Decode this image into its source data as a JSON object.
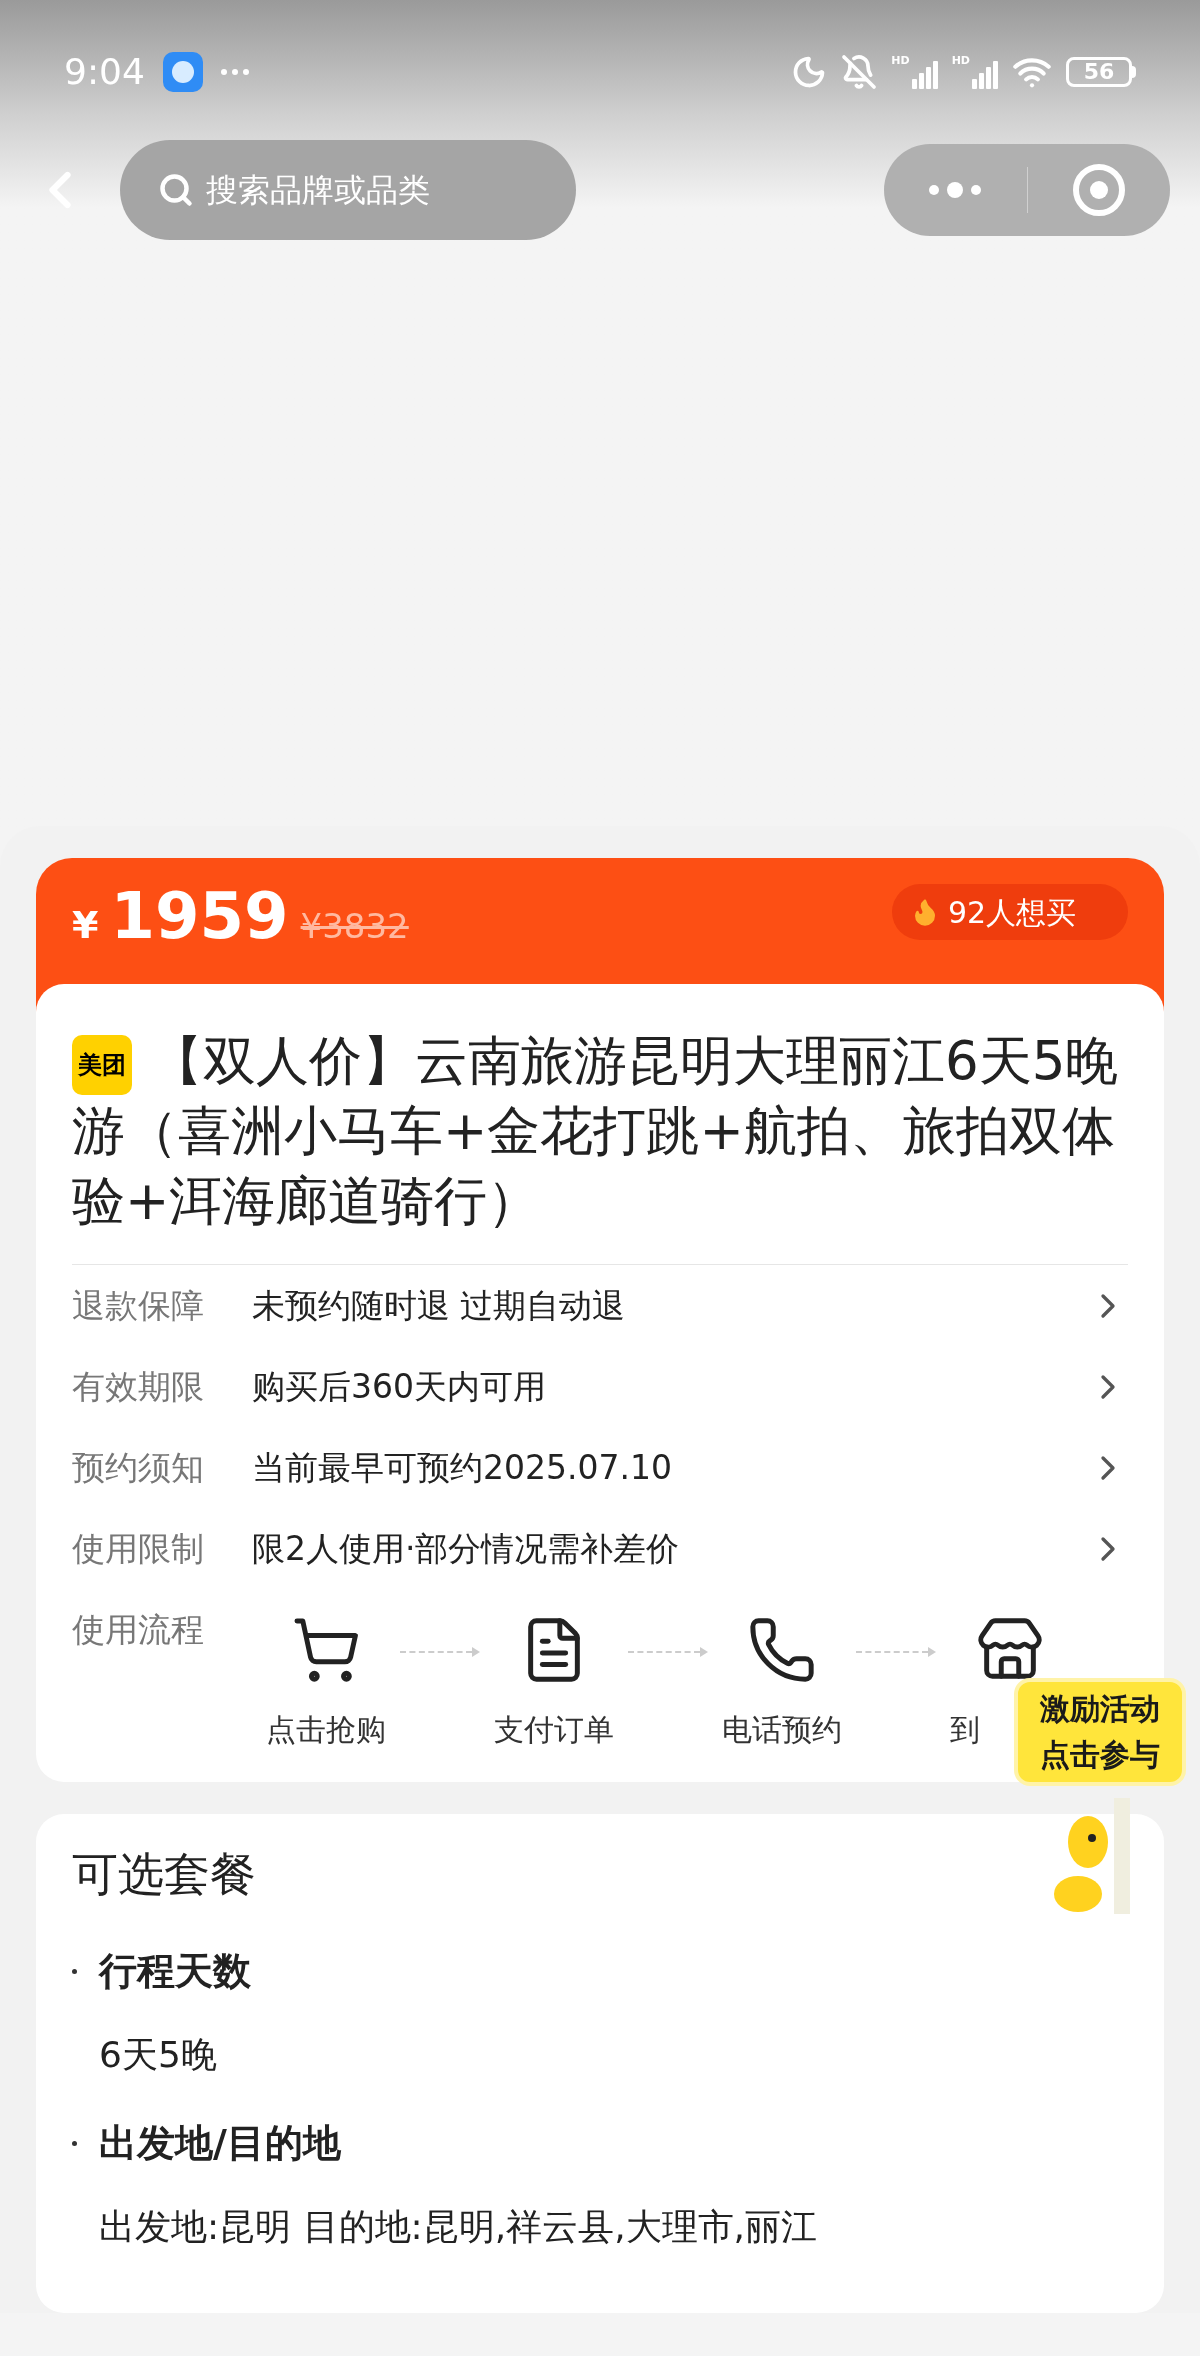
{
  "status_bar": {
    "time": "9:04",
    "signal_labels": [
      "HD",
      "HD"
    ],
    "battery": "56"
  },
  "nav": {
    "search": {
      "placeholder": "搜索品牌或品类"
    }
  },
  "price_banner": {
    "currency": "¥",
    "price": "1959",
    "original_price": "¥3832",
    "popularity": "92人想买"
  },
  "product": {
    "brand": "美团",
    "title": "【双人价】云南旅游昆明大理丽江6天5晚游（喜洲小马车+金花打跳+航拍、旅拍双体验+洱海廊道骑行）"
  },
  "info_rows": [
    {
      "label": "退款保障",
      "value": "未预约随时退 过期自动退"
    },
    {
      "label": "有效期限",
      "value": "购买后360天内可用"
    },
    {
      "label": "预约须知",
      "value": "当前最早可预约2025.07.10"
    },
    {
      "label": "使用限制",
      "value": "限2人使用·部分情况需补差价"
    }
  ],
  "usage_flow": {
    "label": "使用流程",
    "steps": [
      {
        "kind": "cart",
        "label": "点击抢购"
      },
      {
        "kind": "document",
        "label": "支付订单"
      },
      {
        "kind": "phone",
        "label": "电话预约"
      },
      {
        "kind": "store",
        "label": "到"
      }
    ]
  },
  "promo_badge": {
    "lines": [
      "激励活动",
      "点击参与"
    ]
  },
  "packages": {
    "title": "可选套餐",
    "sections": [
      {
        "heading": "行程天数",
        "value": "6天5晚"
      },
      {
        "heading": "出发地/目的地",
        "value": "出发地:昆明 目的地:昆明,祥云县,大理市,丽江"
      }
    ]
  }
}
